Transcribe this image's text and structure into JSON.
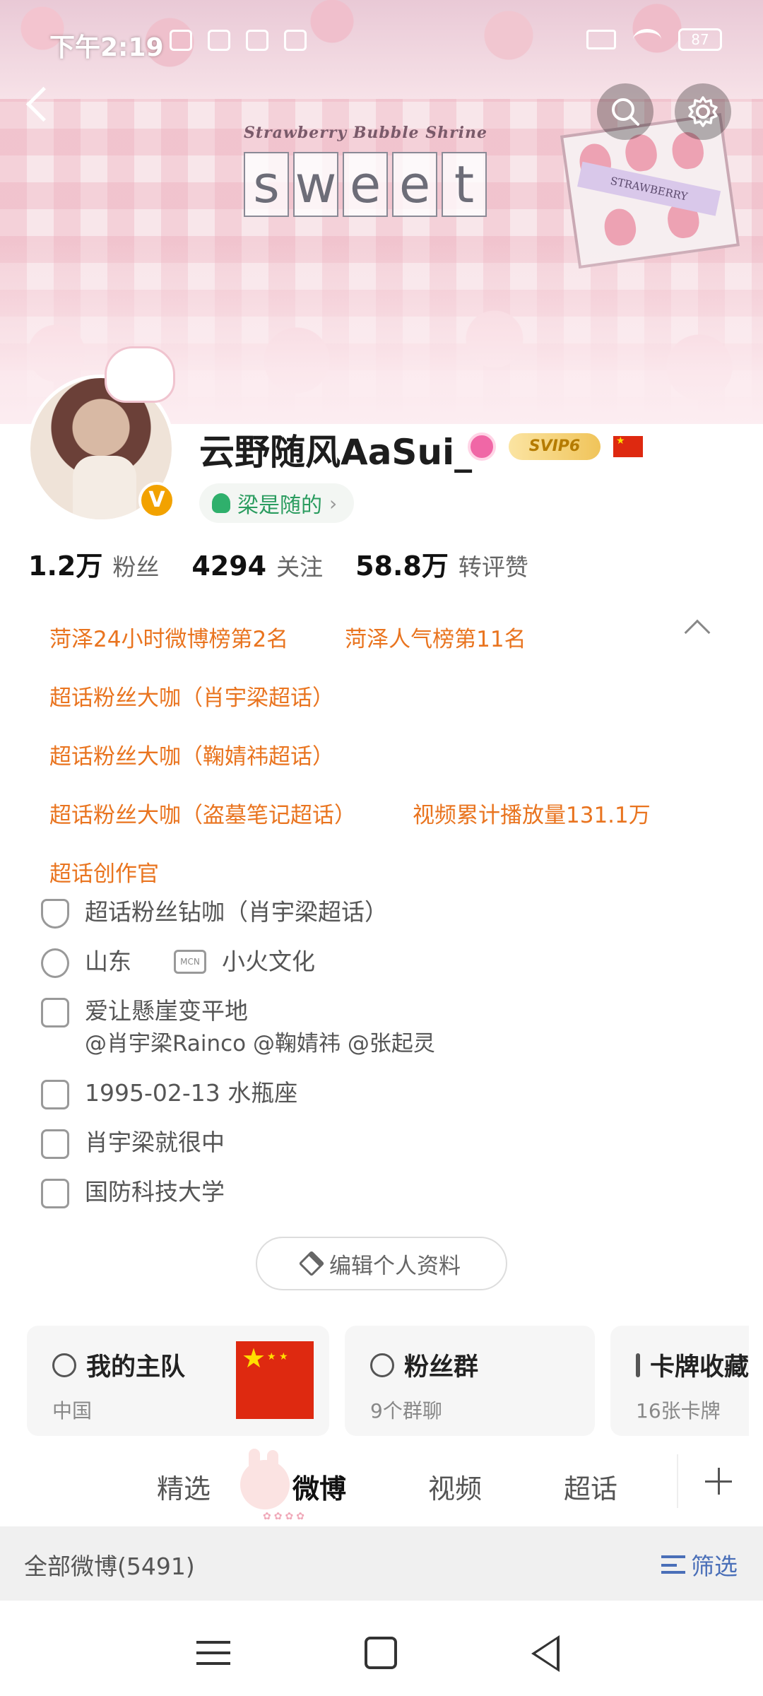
{
  "status_bar": {
    "time": "下午2:19",
    "battery": "87"
  },
  "banner": {
    "shrine_title": "Strawberry Bubble Shrine",
    "sweet_letters": [
      "s",
      "w",
      "e",
      "e",
      "t"
    ],
    "box_tag": "STRAWBERRY"
  },
  "profile": {
    "username": "云野随风AaSui_",
    "verified_badge": "V",
    "svip_label": "SVIP6",
    "affiliation": "梁是随的",
    "affiliation_arrow": "›"
  },
  "stats": [
    {
      "value": "1.2万",
      "label": "粉丝"
    },
    {
      "value": "4294",
      "label": "关注"
    },
    {
      "value": "58.8万",
      "label": "转评赞"
    }
  ],
  "honors": {
    "row1": [
      "菏泽24小时微博榜第2名",
      "菏泽人气榜第11名"
    ],
    "row2": [
      "超话粉丝大咖（肖宇梁超话）"
    ],
    "row3": [
      "超话粉丝大咖（鞠婧祎超话）"
    ],
    "row4": [
      "超话粉丝大咖（盗墓笔记超话）",
      "视频累计播放量131.1万"
    ],
    "row5": [
      "超话创作官"
    ]
  },
  "info": {
    "superchat": "超话粉丝钻咖（肖宇梁超话）",
    "location": "山东",
    "mcn_icon": "MCN",
    "mcn": "小火文化",
    "bio": "爱让懸崖变平地",
    "bio_mentions": "@肖宇梁Rainco @鞠婧祎 @张起灵",
    "birthday": "1995-02-13 水瓶座",
    "company": "肖宇梁就很中",
    "school": "国防科技大学"
  },
  "edit_button": "编辑个人资料",
  "cards": [
    {
      "title": "我的主队",
      "sub": "中国"
    },
    {
      "title": "粉丝群",
      "sub": "9个群聊"
    },
    {
      "title": "卡牌收藏",
      "sub": "16张卡牌"
    }
  ],
  "tabs": {
    "featured": "精选",
    "weibo": "微博",
    "video": "视频",
    "superchat": "超话"
  },
  "filter_bar": {
    "all_posts": "全部微博(5491)",
    "filter": "筛选"
  },
  "colors": {
    "honor_orange": "#e9741f",
    "filter_blue": "#4a6fb8",
    "affiliation_green": "#2a9c5f"
  }
}
